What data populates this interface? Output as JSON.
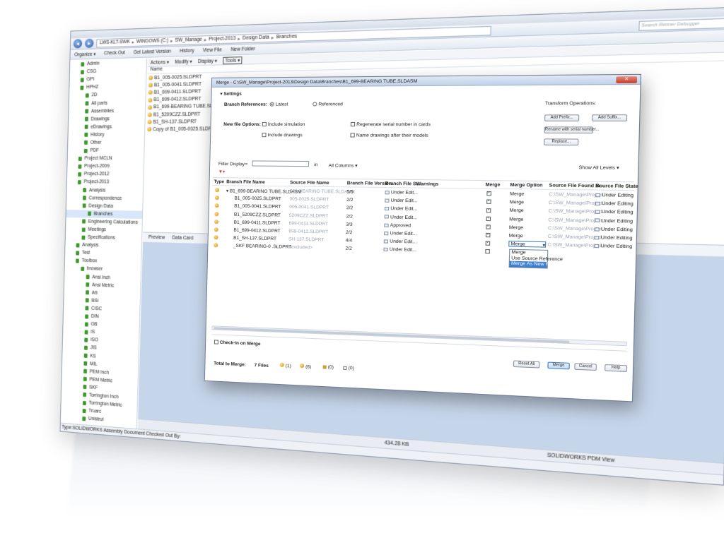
{
  "window": {
    "address": [
      "LWS-KLT-SWK",
      "WINDOWS (C:)",
      "SW_Manage",
      "Project-2013",
      "Design Data",
      "Branches"
    ],
    "search_placeholder": "Search Renner Debugger"
  },
  "commands": [
    "Organize ▾",
    "Check Out",
    "Get Latest Version",
    "History",
    "View File",
    "New Folder"
  ],
  "tree": {
    "items": [
      "Admin",
      "CSG",
      "GPI",
      "HPHZ",
      "2D",
      "All parts",
      "Assemblies",
      "Drawings",
      "eDrawings",
      "History",
      "Other",
      "PDF",
      "Project MCLN",
      "Project-2009",
      "Project-2012",
      "Project-2013",
      "Analysis",
      "Correspondence",
      "Design Data",
      "Branches",
      "Engineering Calculations",
      "Meetings",
      "Specifications",
      "Analysis",
      "Test",
      "Toolbox",
      "browser",
      "Ansi Inch",
      "Ansi Metric",
      "AS",
      "BSI",
      "CISC",
      "DIN",
      "GB",
      "IS",
      "ISO",
      "JIS",
      "KS",
      "MIL",
      "PEM Inch",
      "PEM Metric",
      "SKF",
      "Torrington Inch",
      "Torrington Metric",
      "Truarc",
      "Unistrut"
    ],
    "selected": "Branches"
  },
  "filepane": {
    "menu": [
      "Actions ▾",
      "Modify ▾",
      "Display ▾",
      "Tools ▾"
    ],
    "column_name": "Name",
    "files": [
      "B1_005-0025.SLDPRT",
      "B1_005-0041.SLDPRT",
      "B1_699-0411.SLDPRT",
      "B1_699-0412.SLDPRT",
      "B1_699-BEARING TUBE.SLDASM",
      "B1_5209CZZ.SLDPRT",
      "B1_SH-137.SLDPRT",
      "Copy of B1_005-0025.SLDPRT"
    ]
  },
  "preview_tabs": [
    "Preview",
    "Data Card"
  ],
  "status": {
    "left": "Type:SOLIDWORKS Assembly Document  Checked Out By:",
    "size": "434.28 KB",
    "brand": "SOLIDWORKS PDM View"
  },
  "dialog": {
    "title": "Merge - C:\\SW_Manage\\Project-2013\\Design Data\\Branches\\B1_699-BEARING TUBE.SLDASM",
    "settings_label": "Settings",
    "branch_refs_label": "Branch References:",
    "radio_latest": "Latest",
    "radio_referenced": "Referenced",
    "new_file_options_label": "New file Options:",
    "opt_include_simulation": "Include simulation",
    "opt_include_drawings": "Include drawings",
    "opt_regenerate_serial": "Regenerate serial number in cards",
    "opt_name_drawings": "Name drawings after their models",
    "transform_label": "Transform Operations:",
    "btn_add_prefix": "Add Prefix...",
    "btn_add_suffix": "Add Suffix...",
    "btn_rename_serial": "Rename with serial number...",
    "btn_replace": "Replace...",
    "filter_label": "Filter Display",
    "filter_eq": "=",
    "filter_in": "in",
    "filter_columns": "All Columns ▾",
    "show_levels": "Show All Levels ▾",
    "columns": [
      "Type",
      "Branch File Name",
      "Source File Name",
      "Branch File Version",
      "Branch File St...",
      "Warnings",
      "Merge",
      "Merge Option",
      "Source File Found In",
      "Source File State"
    ],
    "rows": [
      {
        "name": "▾ B1_699-BEARING TUBE.SLDASM",
        "source": "699-BEARING TUBE.SLDASM",
        "version": "5/5",
        "state": "Under Edit...",
        "merge": true,
        "option": "Merge",
        "found": "C:\\SW_Manage\\Project...",
        "srcstate": "Under Editing"
      },
      {
        "name": "B1_005-0025.SLDPRT",
        "source": "005-0025.SLDPRT",
        "version": "2/2",
        "state": "Under Edit...",
        "merge": true,
        "option": "Merge",
        "found": "C:\\SW_Manage\\Project...",
        "srcstate": "Under Editing"
      },
      {
        "name": "B1_005-0041.SLDPRT",
        "source": "005-0041.SLDPRT",
        "version": "2/2",
        "state": "Under Edit...",
        "merge": true,
        "option": "Merge",
        "found": "C:\\SW_Manage\\Project...",
        "srcstate": "Under Editing"
      },
      {
        "name": "B1_5209CZZ.SLDPRT",
        "source": "5209CZZ.SLDPRT",
        "version": "2/2",
        "state": "Under Edit...",
        "merge": true,
        "option": "Merge",
        "found": "C:\\SW_Manage\\Project...",
        "srcstate": "Under Editing"
      },
      {
        "name": "B1_699-0411.SLDPRT",
        "source": "699-0411.SLDPRT",
        "version": "3/3",
        "state": "Approved",
        "merge": true,
        "option": "Merge",
        "found": "C:\\SW_Manage\\Project...",
        "srcstate": "Under Editing"
      },
      {
        "name": "B1_699-0412.SLDPRT",
        "source": "699-0412.SLDPRT",
        "version": "2/2",
        "state": "Under Edit...",
        "merge": true,
        "option": "Merge",
        "found": "C:\\SW_Manage\\Project...",
        "srcstate": "Under Editing"
      },
      {
        "name": "B1_SH-137.SLDPRT",
        "source": "SH-137.SLDPRT",
        "version": "4/4",
        "state": "Under Edit...",
        "merge": true,
        "option": "Merge",
        "found": "C:\\SW_Manage\\Project...",
        "srcstate": "Under Editing"
      },
      {
        "name": "_SKF BEARING-0 .SLDPRT",
        "source": "<excluded>",
        "version": "2/2",
        "state": "Under Edit...",
        "merge": false,
        "option": "",
        "found": "",
        "srcstate": ""
      }
    ],
    "dropdown_options": [
      "Merge",
      "Use Source Reference",
      "Merge As New File"
    ],
    "checkin_label": "Check-in on Merge",
    "total_label": "Total to Merge:",
    "total_value": "7 Files",
    "counts": [
      "(1)",
      "(6)",
      "(0)",
      "(0)"
    ],
    "btn_reset": "Reset All",
    "btn_merge": "Merge",
    "btn_cancel": "Cancel",
    "btn_help": "Help"
  }
}
